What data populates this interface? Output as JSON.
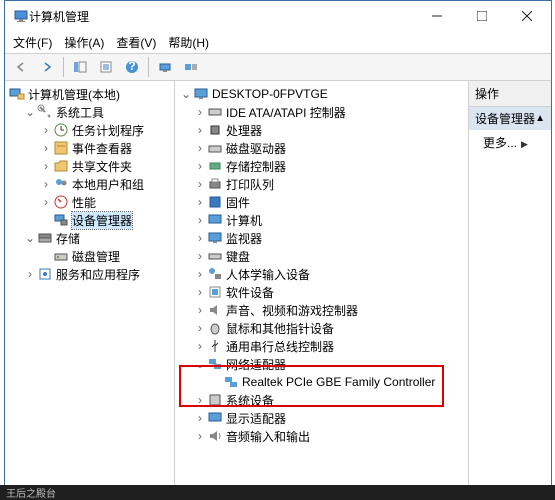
{
  "title": "计算机管理",
  "menu": {
    "file": "文件(F)",
    "action": "操作(A)",
    "view": "查看(V)",
    "help": "帮助(H)"
  },
  "left_tree": {
    "root": "计算机管理(本地)",
    "system_tools": "系统工具",
    "task_scheduler": "任务计划程序",
    "event_viewer": "事件查看器",
    "shared_folders": "共享文件夹",
    "local_users": "本地用户和组",
    "performance": "性能",
    "device_manager": "设备管理器",
    "storage": "存储",
    "disk_mgmt": "磁盘管理",
    "services_apps": "服务和应用程序"
  },
  "mid_tree": {
    "root": "DESKTOP-0FPVTGE",
    "items": [
      "IDE ATA/ATAPI 控制器",
      "处理器",
      "磁盘驱动器",
      "存储控制器",
      "打印队列",
      "固件",
      "计算机",
      "监视器",
      "键盘",
      "人体学输入设备",
      "软件设备",
      "声音、视频和游戏控制器",
      "鼠标和其他指针设备",
      "通用串行总线控制器",
      "网络适配器",
      "Realtek PCIe GBE Family Controller",
      "系统设备",
      "显示适配器",
      "音频输入和输出"
    ]
  },
  "right": {
    "header": "操作",
    "section": "设备管理器",
    "more": "更多..."
  },
  "taskbar_text": "王后之殿台"
}
